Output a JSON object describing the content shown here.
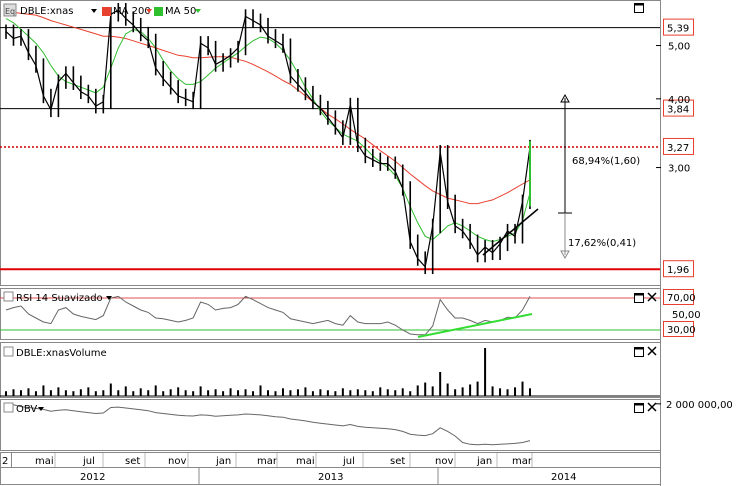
{
  "panels": {
    "price": {
      "title": "DBLE:xnas",
      "ma_long_label": "MA 200",
      "ma_short_label": "MA 50"
    },
    "rsi": {
      "title": "RSI 14 Suavizado"
    },
    "volume": {
      "title": "DBLE:xnasVolume"
    },
    "obv": {
      "title": "OBV"
    }
  },
  "colors": {
    "price": "#000000",
    "ma200": "#e8402e",
    "ma50": "#2fbf2f",
    "resistance": "#000000",
    "support": "#e00000",
    "current": "#cc0000",
    "trendline": "#000000",
    "rsi_trend": "#33dd33",
    "grid": "#c8c8c8"
  },
  "chart_data": [
    {
      "type": "line",
      "panel": "price",
      "scale": "log",
      "ylim": [
        1.85,
        6.0
      ],
      "y_ticks": [
        5.0,
        4.0,
        3.0
      ],
      "y_tick_labels": [
        "5,00",
        "4,00",
        "3,00"
      ],
      "series": [
        {
          "name": "DBLE:xnas",
          "kind": "ohlc-close",
          "values": [
            5.3,
            5.15,
            5.2,
            4.85,
            4.6,
            4.05,
            3.82,
            4.3,
            4.45,
            4.28,
            4.12,
            4.05,
            3.88,
            3.95,
            5.7,
            5.8,
            5.6,
            5.45,
            5.25,
            5.1,
            4.55,
            4.35,
            4.2,
            4.05,
            4.0,
            3.95,
            5.05,
            4.95,
            4.62,
            4.7,
            4.8,
            4.95,
            5.65,
            5.55,
            5.45,
            5.2,
            5.1,
            5.0,
            4.4,
            4.25,
            4.1,
            3.95,
            3.85,
            3.7,
            3.55,
            3.4,
            3.9,
            3.3,
            3.15,
            3.1,
            3.05,
            3.05,
            2.95,
            2.75,
            2.2,
            2.05,
            1.98,
            2.35,
            3.2,
            2.6,
            2.35,
            2.3,
            2.2,
            2.08,
            2.15,
            2.1,
            2.18,
            2.3,
            2.25,
            2.6,
            3.27
          ]
        },
        {
          "name": "MA 200",
          "values": [
            5.8,
            5.75,
            5.72,
            5.7,
            5.68,
            5.62,
            5.55,
            5.5,
            5.45,
            5.4,
            5.35,
            5.3,
            5.25,
            5.2,
            5.2,
            5.18,
            5.15,
            5.1,
            5.05,
            5.0,
            4.95,
            4.9,
            4.85,
            4.8,
            4.78,
            4.75,
            4.75,
            4.76,
            4.77,
            4.77,
            4.76,
            4.72,
            4.68,
            4.62,
            4.55,
            4.48,
            4.4,
            4.32,
            4.25,
            4.15,
            4.05,
            3.95,
            3.85,
            3.75,
            3.68,
            3.6,
            3.52,
            3.45,
            3.38,
            3.3,
            3.22,
            3.15,
            3.08,
            3.0,
            2.92,
            2.85,
            2.78,
            2.72,
            2.68,
            2.64,
            2.62,
            2.6,
            2.58,
            2.58,
            2.6,
            2.62,
            2.66,
            2.7,
            2.75,
            2.8,
            2.85
          ]
        },
        {
          "name": "MA 50",
          "values": [
            5.6,
            5.5,
            5.35,
            5.2,
            5.05,
            4.85,
            4.6,
            4.4,
            4.3,
            4.25,
            4.2,
            4.15,
            4.1,
            4.2,
            4.55,
            4.95,
            5.25,
            5.35,
            5.3,
            5.15,
            4.95,
            4.7,
            4.5,
            4.35,
            4.25,
            4.25,
            4.3,
            4.42,
            4.55,
            4.65,
            4.75,
            4.85,
            4.98,
            5.1,
            5.18,
            5.15,
            5.05,
            4.9,
            4.7,
            4.45,
            4.2,
            4.0,
            3.8,
            3.65,
            3.55,
            3.45,
            3.4,
            3.35,
            3.25,
            3.15,
            3.07,
            3.0,
            2.9,
            2.75,
            2.55,
            2.38,
            2.25,
            2.22,
            2.28,
            2.35,
            2.38,
            2.35,
            2.3,
            2.25,
            2.22,
            2.2,
            2.22,
            2.25,
            2.28,
            2.4,
            2.7
          ]
        }
      ],
      "levels": [
        {
          "label": "5,39",
          "value": 5.39
        },
        {
          "label": "3,84",
          "value": 3.84
        },
        {
          "label": "3,27",
          "value": 3.27
        },
        {
          "label": "1,96",
          "value": 1.96
        }
      ],
      "annotations": [
        {
          "text": "68,94%(1,60)"
        },
        {
          "text": "17,62%(0,41)"
        }
      ]
    },
    {
      "type": "line",
      "panel": "rsi",
      "ylim": [
        20,
        80
      ],
      "levels": [
        {
          "label": "70,00",
          "value": 70
        },
        {
          "label": "30,00",
          "value": 30
        }
      ],
      "mid_label": "50,00",
      "values": [
        55,
        58,
        60,
        50,
        45,
        40,
        38,
        55,
        58,
        50,
        47,
        45,
        43,
        48,
        70,
        72,
        65,
        60,
        55,
        52,
        45,
        44,
        42,
        40,
        42,
        45,
        65,
        62,
        55,
        57,
        58,
        62,
        72,
        68,
        63,
        58,
        55,
        52,
        44,
        42,
        40,
        38,
        40,
        42,
        38,
        36,
        48,
        40,
        38,
        38,
        38,
        40,
        36,
        30,
        25,
        24,
        24,
        35,
        68,
        55,
        45,
        45,
        42,
        38,
        42,
        40,
        42,
        46,
        45,
        55,
        72
      ]
    },
    {
      "type": "bar",
      "panel": "volume",
      "values": [
        10,
        14,
        12,
        16,
        10,
        22,
        12,
        18,
        12,
        10,
        14,
        18,
        10,
        12,
        26,
        12,
        20,
        10,
        16,
        12,
        22,
        10,
        14,
        18,
        12,
        10,
        20,
        12,
        14,
        10,
        16,
        12,
        14,
        10,
        22,
        12,
        10,
        16,
        12,
        14,
        18,
        10,
        14,
        12,
        10,
        16,
        12,
        14,
        12,
        10,
        18,
        14,
        12,
        16,
        10,
        22,
        28,
        20,
        50,
        26,
        14,
        18,
        24,
        30,
        100,
        20,
        16,
        14,
        18,
        30,
        16
      ]
    },
    {
      "type": "line",
      "panel": "obv",
      "y_ticks": [
        2000000
      ],
      "y_tick_labels": [
        "2 000 000,00"
      ],
      "values": [
        2000000,
        1990000,
        1970000,
        1960000,
        1950000,
        1940000,
        1920000,
        1930000,
        1935000,
        1925000,
        1915000,
        1905000,
        1895000,
        1900000,
        1960000,
        1965000,
        1955000,
        1945000,
        1935000,
        1925000,
        1905000,
        1895000,
        1885000,
        1875000,
        1870000,
        1868000,
        1880000,
        1875000,
        1865000,
        1870000,
        1875000,
        1880000,
        1890000,
        1885000,
        1880000,
        1870000,
        1860000,
        1855000,
        1835000,
        1825000,
        1815000,
        1800000,
        1790000,
        1780000,
        1770000,
        1760000,
        1775000,
        1755000,
        1745000,
        1740000,
        1735000,
        1730000,
        1720000,
        1700000,
        1670000,
        1660000,
        1655000,
        1675000,
        1740000,
        1700000,
        1650000,
        1580000,
        1560000,
        1555000,
        1560000,
        1555000,
        1560000,
        1565000,
        1570000,
        1580000,
        1600000
      ]
    }
  ],
  "x_axis": {
    "left_cut_label": "2",
    "month_labels": [
      "mai",
      "jul",
      "set",
      "nov",
      "jan",
      "mar",
      "mai",
      "jul",
      "set",
      "nov",
      "jan",
      "mar"
    ],
    "year_labels": [
      "2012",
      "2013",
      "2014"
    ]
  }
}
